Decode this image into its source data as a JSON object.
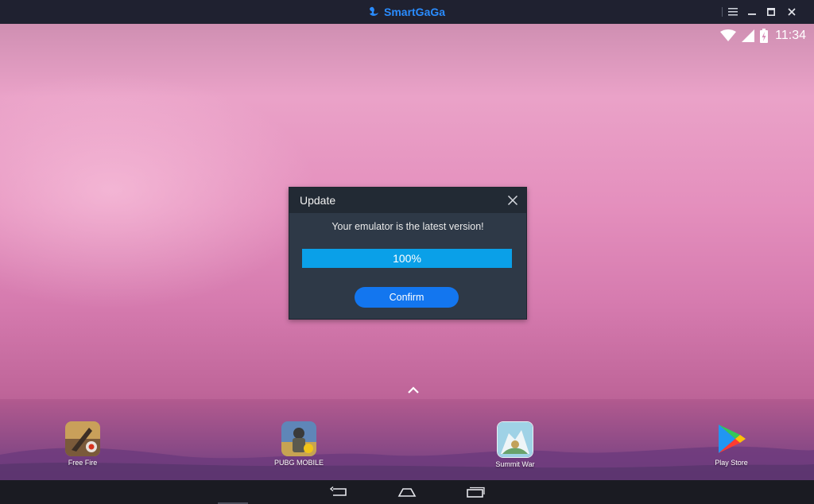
{
  "window": {
    "brand": "SmartGaGa",
    "brand_color": "#2a8cff",
    "controls": [
      "menu-icon",
      "minimize-icon",
      "maximize-icon",
      "close-icon"
    ]
  },
  "status_bar": {
    "icons": [
      "wifi-icon",
      "signal-icon",
      "battery-charging-icon"
    ],
    "time": "11:34"
  },
  "dialog": {
    "title": "Update",
    "message": "Your emulator is the latest version!",
    "progress_percent": 100,
    "progress_label": "100%",
    "confirm_label": "Confirm",
    "accent_color": "#1376ef",
    "progress_color": "#0aa0e8"
  },
  "dock": {
    "apps": [
      {
        "label": "Free Fire",
        "icon": "free-fire-icon"
      },
      {
        "label": "PUBG MOBILE",
        "icon": "pubg-mobile-icon"
      },
      {
        "label": "Summit War",
        "icon": "summit-war-icon"
      },
      {
        "label": "Play Store",
        "icon": "play-store-icon"
      }
    ]
  },
  "nav_bar": {
    "buttons": [
      "back-icon",
      "home-icon",
      "recents-icon"
    ]
  }
}
